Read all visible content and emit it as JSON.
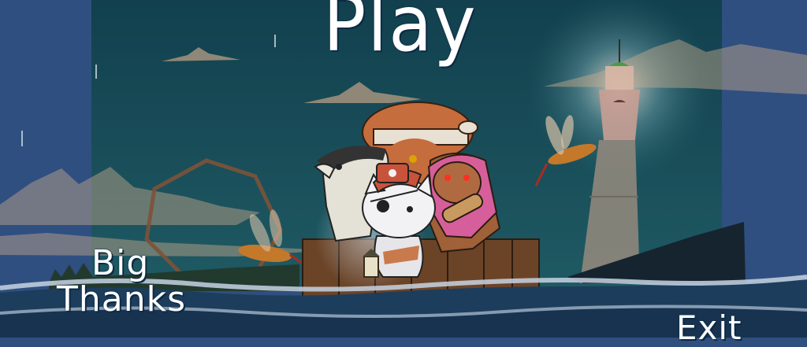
{
  "menu": {
    "play_label": "Play",
    "big_thanks_line1": "Big",
    "big_thanks_line2": "Thanks",
    "exit_label": "Exit"
  },
  "colors": {
    "side_panel": "#2f4f80",
    "night_sky_top": "#14414f",
    "night_sky_bottom": "#1e5660",
    "sea": "#1d3d5c",
    "wave_foam": "#c7d3e3",
    "lighthouse_glow": "#f2a690",
    "raft_wood": "#6b4428",
    "cat_hat": "#c9533a"
  },
  "icons": [
    "raft-icon",
    "pirate-cat-icon",
    "badger-icon",
    "bear-icon",
    "brown-bear-icon",
    "mosquito-icon",
    "lighthouse-icon",
    "hexagon-frame-icon",
    "lantern-icon"
  ]
}
